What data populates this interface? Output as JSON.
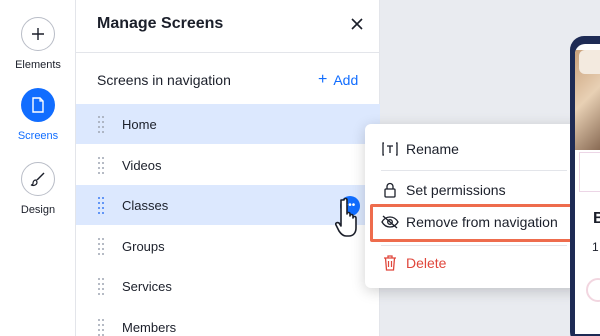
{
  "rail": {
    "items": [
      {
        "label": "Elements",
        "icon": "plus-icon",
        "active": false
      },
      {
        "label": "Screens",
        "icon": "page-icon",
        "active": true
      },
      {
        "label": "Design",
        "icon": "brush-icon",
        "active": false
      }
    ]
  },
  "panel": {
    "title": "Manage Screens",
    "close_icon": "close-icon",
    "section_title": "Screens in navigation",
    "add_label": "Add",
    "screens": [
      {
        "label": "Home",
        "highlighted": true
      },
      {
        "label": "Videos",
        "highlighted": false
      },
      {
        "label": "Classes",
        "highlighted": true
      },
      {
        "label": "Groups",
        "highlighted": false
      },
      {
        "label": "Services",
        "highlighted": false
      },
      {
        "label": "Members",
        "highlighted": false
      }
    ]
  },
  "context_menu": {
    "items": [
      {
        "label": "Rename",
        "icon": "rename-icon"
      },
      {
        "label": "Set permissions",
        "icon": "lock-icon"
      },
      {
        "label": "Remove from navigation",
        "icon": "eye-off-icon",
        "highlighted": true
      },
      {
        "label": "Delete",
        "icon": "trash-icon",
        "destructive": true
      }
    ]
  },
  "preview": {
    "heading_fragment": "B",
    "text_fragment": "1"
  },
  "colors": {
    "accent": "#116dff",
    "row_highlight": "#dce8fe",
    "danger": "#e0473c",
    "callout": "#ee6c4d"
  }
}
